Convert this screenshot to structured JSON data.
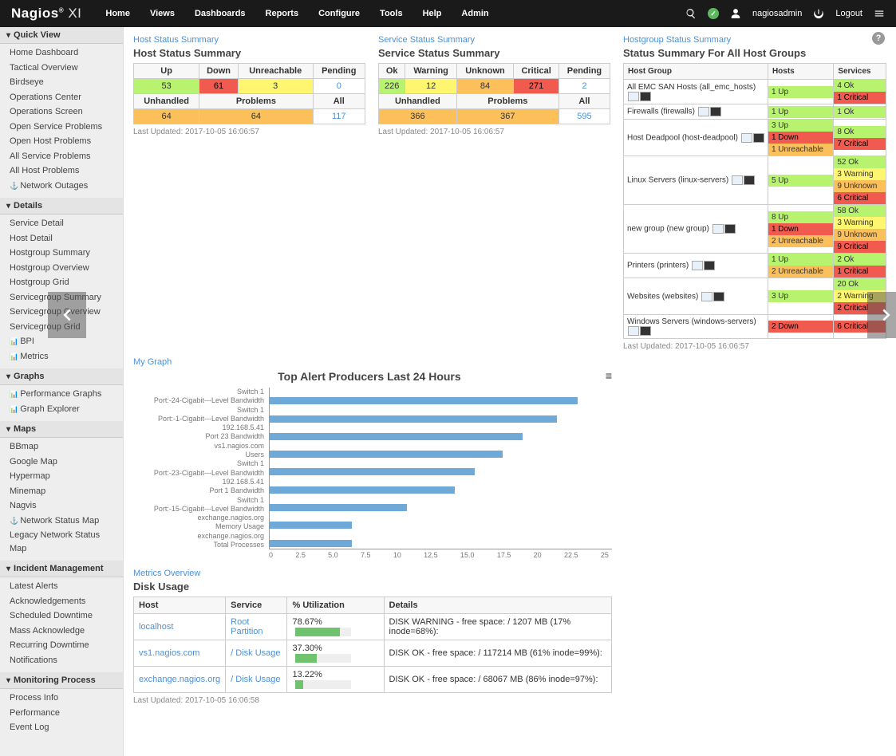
{
  "brand": {
    "name": "Nagios",
    "suffix": "XI",
    "reg": "®"
  },
  "topnav": [
    "Home",
    "Views",
    "Dashboards",
    "Reports",
    "Configure",
    "Tools",
    "Help",
    "Admin"
  ],
  "user": {
    "name": "nagiosadmin",
    "logout": "Logout"
  },
  "sidebar": [
    {
      "title": "Quick View",
      "items": [
        "Home Dashboard",
        "Tactical Overview",
        "Birdseye",
        "Operations Center",
        "Operations Screen",
        "Open Service Problems",
        "Open Host Problems",
        "All Service Problems",
        "All Host Problems",
        "Network Outages"
      ]
    },
    {
      "title": "Details",
      "items": [
        "Service Detail",
        "Host Detail",
        "Hostgroup Summary",
        "Hostgroup Overview",
        "Hostgroup Grid",
        "Servicegroup Summary",
        "Servicegroup Overview",
        "Servicegroup Grid",
        "BPI",
        "Metrics"
      ]
    },
    {
      "title": "Graphs",
      "items": [
        "Performance Graphs",
        "Graph Explorer"
      ]
    },
    {
      "title": "Maps",
      "items": [
        "BBmap",
        "Google Map",
        "Hypermap",
        "Minemap",
        "Nagvis",
        "Network Status Map",
        "Legacy Network Status Map"
      ]
    },
    {
      "title": "Incident Management",
      "items": [
        "Latest Alerts",
        "Acknowledgements",
        "Scheduled Downtime",
        "Mass Acknowledge",
        "Recurring Downtime",
        "Notifications"
      ]
    },
    {
      "title": "Monitoring Process",
      "items": [
        "Process Info",
        "Performance",
        "Event Log"
      ]
    }
  ],
  "host_status": {
    "link": "Host Status Summary",
    "title": "Host Status Summary",
    "hdr1": [
      "Up",
      "Down",
      "Unreachable",
      "Pending"
    ],
    "row1": [
      {
        "v": "53",
        "c": "c-green"
      },
      {
        "v": "61",
        "c": "c-red"
      },
      {
        "v": "3",
        "c": "c-yellow"
      },
      {
        "v": "0",
        "c": ""
      }
    ],
    "hdr2": [
      "Unhandled",
      "Problems",
      "All"
    ],
    "row2": [
      {
        "v": "64",
        "c": "c-orange"
      },
      {
        "v": "64",
        "c": "c-orange"
      },
      {
        "v": "117",
        "c": ""
      }
    ],
    "updated": "Last Updated: 2017-10-05 16:06:57"
  },
  "svc_status": {
    "link": "Service Status Summary",
    "title": "Service Status Summary",
    "hdr1": [
      "Ok",
      "Warning",
      "Unknown",
      "Critical",
      "Pending"
    ],
    "row1": [
      {
        "v": "226",
        "c": "c-green"
      },
      {
        "v": "12",
        "c": "c-yellow"
      },
      {
        "v": "84",
        "c": "c-orange"
      },
      {
        "v": "271",
        "c": "c-red"
      },
      {
        "v": "2",
        "c": ""
      }
    ],
    "hdr2": [
      "Unhandled",
      "Problems",
      "All"
    ],
    "row2": [
      {
        "v": "366",
        "c": "c-orange"
      },
      {
        "v": "367",
        "c": "c-orange"
      },
      {
        "v": "595",
        "c": ""
      }
    ],
    "updated": "Last Updated: 2017-10-05 16:06:57"
  },
  "chart_data": {
    "type": "bar",
    "title": "Top Alert Producers Last 24 Hours",
    "categories": [
      "Switch 1",
      "Port:-24-Cigabit---Level Bandwidth",
      "Switch 1",
      "Port:-1-Cigabit---Level Bandwidth",
      "192.168.5.41",
      "Port 23 Bandwidth",
      "vs1.nagios.com",
      "Users",
      "Switch 1",
      "Port:-23-Cigabit---Level Bandwidth",
      "192.168.5.41",
      "Port 1 Bandwidth",
      "Switch 1",
      "Port:-15-Cigabit---Level Bandwidth",
      "exchange.nagios.org",
      "Memory Usage",
      "exchange.nagios.org",
      "Total Processes"
    ],
    "values": [
      null,
      22.5,
      null,
      21,
      null,
      18.5,
      null,
      17,
      null,
      15,
      null,
      13.5,
      null,
      10,
      null,
      6,
      null,
      6
    ],
    "grouped": [
      {
        "host": "Switch 1",
        "service": "Port:-24-Cigabit---Level Bandwidth",
        "value": 22.5
      },
      {
        "host": "Switch 1",
        "service": "Port:-1-Cigabit---Level Bandwidth",
        "value": 21
      },
      {
        "host": "192.168.5.41",
        "service": "Port 23 Bandwidth",
        "value": 18.5
      },
      {
        "host": "vs1.nagios.com",
        "service": "Users",
        "value": 17
      },
      {
        "host": "Switch 1",
        "service": "Port:-23-Cigabit---Level Bandwidth",
        "value": 15
      },
      {
        "host": "192.168.5.41",
        "service": "Port 1 Bandwidth",
        "value": 13.5
      },
      {
        "host": "Switch 1",
        "service": "Port:-15-Cigabit---Level Bandwidth",
        "value": 10
      },
      {
        "host": "exchange.nagios.org",
        "service": "Memory Usage",
        "value": 6
      },
      {
        "host": "exchange.nagios.org",
        "service": "Total Processes",
        "value": 6
      }
    ],
    "xlabel": "",
    "ylabel": "",
    "xlim": [
      0,
      25
    ],
    "ticks": [
      "0",
      "2.5",
      "5.0",
      "7.5",
      "10",
      "12.5",
      "15.0",
      "17.5",
      "20",
      "22.5",
      "25"
    ]
  },
  "graph_link": "My Graph",
  "hg": {
    "link": "Hostgroup Status Summary",
    "title": "Status Summary For All Host Groups",
    "cols": [
      "Host Group",
      "Hosts",
      "Services"
    ],
    "rows": [
      {
        "name": "All EMC SAN Hosts (all_emc_hosts)",
        "hosts": [
          {
            "t": "1 Up",
            "c": "c-green"
          }
        ],
        "svcs": [
          {
            "t": "4 Ok",
            "c": "c-green"
          },
          {
            "t": "1 Critical",
            "c": "c-red"
          }
        ]
      },
      {
        "name": "Firewalls (firewalls)",
        "hosts": [
          {
            "t": "1 Up",
            "c": "c-green"
          }
        ],
        "svcs": [
          {
            "t": "1 Ok",
            "c": "c-green"
          }
        ]
      },
      {
        "name": "Host Deadpool (host-deadpool)",
        "hosts": [
          {
            "t": "3 Up",
            "c": "c-green"
          },
          {
            "t": "1 Down",
            "c": "c-red"
          },
          {
            "t": "1 Unreachable",
            "c": "c-orange"
          }
        ],
        "svcs": [
          {
            "t": "8 Ok",
            "c": "c-green"
          },
          {
            "t": "7 Critical",
            "c": "c-red"
          }
        ]
      },
      {
        "name": "Linux Servers (linux-servers)",
        "hosts": [
          {
            "t": "5 Up",
            "c": "c-green"
          }
        ],
        "svcs": [
          {
            "t": "52 Ok",
            "c": "c-green"
          },
          {
            "t": "3 Warning",
            "c": "c-yellow"
          },
          {
            "t": "9 Unknown",
            "c": "c-orange"
          },
          {
            "t": "6 Critical",
            "c": "c-red"
          }
        ]
      },
      {
        "name": "new group (new group)",
        "hosts": [
          {
            "t": "8 Up",
            "c": "c-green"
          },
          {
            "t": "1 Down",
            "c": "c-red"
          },
          {
            "t": "2 Unreachable",
            "c": "c-orange"
          }
        ],
        "svcs": [
          {
            "t": "58 Ok",
            "c": "c-green"
          },
          {
            "t": "3 Warning",
            "c": "c-yellow"
          },
          {
            "t": "9 Unknown",
            "c": "c-orange"
          },
          {
            "t": "9 Critical",
            "c": "c-red"
          }
        ]
      },
      {
        "name": "Printers (printers)",
        "hosts": [
          {
            "t": "1 Up",
            "c": "c-green"
          },
          {
            "t": "2 Unreachable",
            "c": "c-orange"
          }
        ],
        "svcs": [
          {
            "t": "2 Ok",
            "c": "c-green"
          },
          {
            "t": "1 Critical",
            "c": "c-red"
          }
        ]
      },
      {
        "name": "Websites (websites)",
        "hosts": [
          {
            "t": "3 Up",
            "c": "c-green"
          }
        ],
        "svcs": [
          {
            "t": "20 Ok",
            "c": "c-green"
          },
          {
            "t": "2 Warning",
            "c": "c-yellow"
          },
          {
            "t": "2 Critical",
            "c": "c-red"
          }
        ]
      },
      {
        "name": "Windows Servers (windows-servers)",
        "hosts": [
          {
            "t": "2 Down",
            "c": "c-red"
          }
        ],
        "svcs": [
          {
            "t": "6 Critical",
            "c": "c-red"
          }
        ]
      }
    ],
    "updated": "Last Updated: 2017-10-05 16:06:57"
  },
  "metrics": {
    "link": "Metrics Overview",
    "title": "Disk Usage",
    "cols": [
      "Host",
      "Service",
      "% Utilization",
      "Details"
    ],
    "rows": [
      {
        "host": "localhost",
        "svc": "Root Partition",
        "util": "78.67%",
        "pct": 78.67,
        "details": "DISK WARNING - free space: / 1207 MB (17% inode=68%):"
      },
      {
        "host": "vs1.nagios.com",
        "svc": "/ Disk Usage",
        "util": "37.30%",
        "pct": 37.3,
        "details": "DISK OK - free space: / 117214 MB (61% inode=99%):"
      },
      {
        "host": "exchange.nagios.org",
        "svc": "/ Disk Usage",
        "util": "13.22%",
        "pct": 13.22,
        "details": "DISK OK - free space: / 68067 MB (86% inode=97%):"
      }
    ],
    "updated": "Last Updated: 2017-10-05 16:06:58"
  }
}
